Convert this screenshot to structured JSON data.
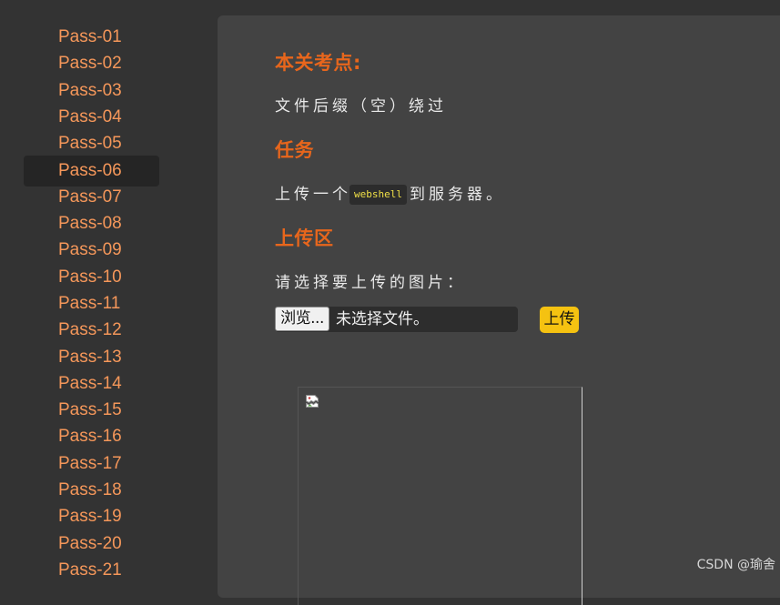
{
  "sidebar": {
    "items": [
      {
        "label": "Pass-01"
      },
      {
        "label": "Pass-02"
      },
      {
        "label": "Pass-03"
      },
      {
        "label": "Pass-04"
      },
      {
        "label": "Pass-05"
      },
      {
        "label": "Pass-06"
      },
      {
        "label": "Pass-07"
      },
      {
        "label": "Pass-08"
      },
      {
        "label": "Pass-09"
      },
      {
        "label": "Pass-10"
      },
      {
        "label": "Pass-11"
      },
      {
        "label": "Pass-12"
      },
      {
        "label": "Pass-13"
      },
      {
        "label": "Pass-14"
      },
      {
        "label": "Pass-15"
      },
      {
        "label": "Pass-16"
      },
      {
        "label": "Pass-17"
      },
      {
        "label": "Pass-18"
      },
      {
        "label": "Pass-19"
      },
      {
        "label": "Pass-20"
      },
      {
        "label": "Pass-21"
      }
    ],
    "active": "Pass-06"
  },
  "main": {
    "section_point": {
      "heading": "本关考点:",
      "text": "文件后缀（空）绕过"
    },
    "section_task": {
      "heading": "任务",
      "text_before": "上传一个",
      "code": "webshell",
      "text_after": "到服务器。"
    },
    "section_upload": {
      "heading": "上传区",
      "prompt": "请选择要上传的图片：",
      "browse_label": "浏览...",
      "file_status": "未选择文件。",
      "upload_label": "上传"
    },
    "preview": {
      "icon": "broken-image-icon"
    }
  },
  "watermark": "CSDN @瑜舍",
  "colors": {
    "background": "#333333",
    "panel": "#434343",
    "link": "#f5975a",
    "heading": "#e8661c",
    "code_text": "#f0e047",
    "upload_button": "#f5c211"
  }
}
